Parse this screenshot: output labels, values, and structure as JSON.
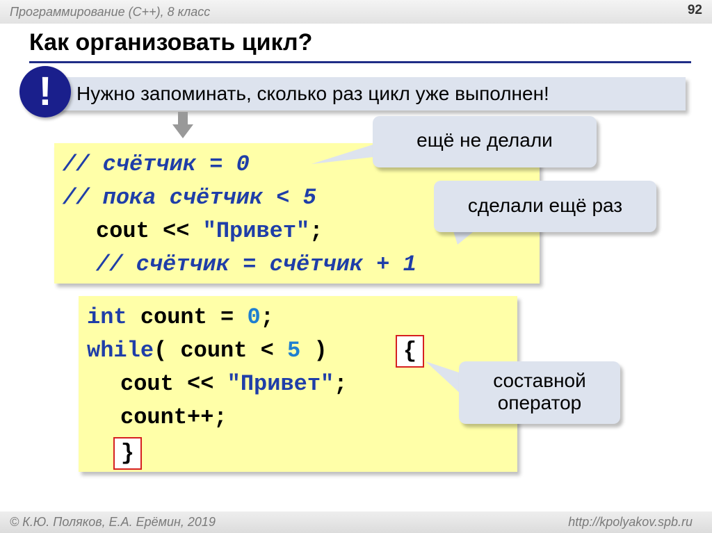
{
  "header": {
    "course": "Программирование (С++), 8 класс",
    "page_number": "92"
  },
  "slide": {
    "title": "Как организовать цикл?",
    "alert_icon": "!",
    "alert_text": "Нужно запоминать, сколько раз цикл уже выполнен!"
  },
  "pseudocode": {
    "line1": "// счётчик = 0",
    "line2": "// пока счётчик < 5",
    "line3_code": "cout << ",
    "line3_str": "\"Привет\"",
    "line3_end": ";",
    "line4": "// счётчик = счётчик + 1"
  },
  "code": {
    "l1_kw": "int",
    "l1_mid": " count = ",
    "l1_num": "0",
    "l1_end": ";",
    "l2_kw": "while",
    "l2_mid": "( count < ",
    "l2_num": "5",
    "l2_end": " )",
    "open_brace": "{",
    "l3_code": "cout << ",
    "l3_str": "\"Привет\"",
    "l3_end": ";",
    "l4": "count++;",
    "close_brace": "}"
  },
  "callouts": {
    "not_done": "ещё не делали",
    "done_again": "сделали ещё раз",
    "compound_1": "составной",
    "compound_2": "оператор"
  },
  "footer": {
    "authors": "© К.Ю. Поляков, Е.А. Ерёмин, 2019",
    "url": "http://kpolyakov.spb.ru"
  },
  "colors": {
    "accent": "#1f2d86",
    "code_bg": "#ffffa8",
    "callout_bg": "#dde3ee",
    "brace_border": "#d62020"
  }
}
